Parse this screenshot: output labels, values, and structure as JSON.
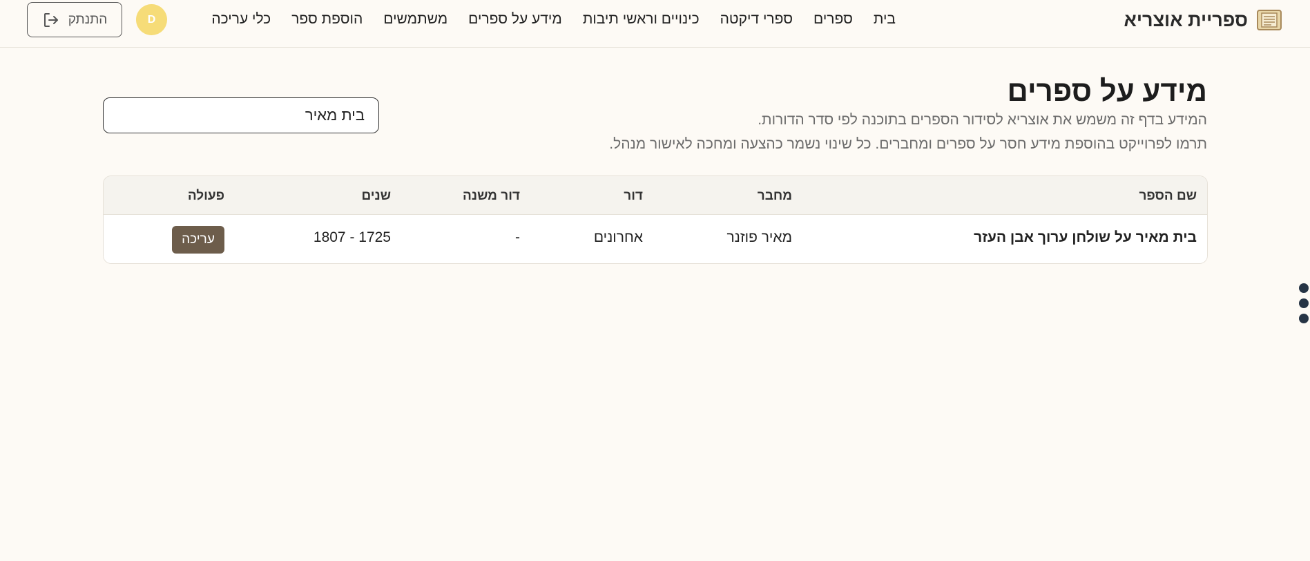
{
  "header": {
    "brand": "ספריית אוצריא",
    "nav": [
      "בית",
      "ספרים",
      "ספרי דיקטה",
      "כינויים וראשי תיבות",
      "מידע על ספרים",
      "משתמשים",
      "הוספת ספר",
      "כלי עריכה"
    ],
    "avatar_initial": "D",
    "logout_label": "התנתק"
  },
  "page": {
    "title": "מידע על ספרים",
    "description_1": "המידע בדף זה משמש את אוצריא לסידור הספרים בתוכנה לפי סדר הדורות.",
    "description_2": "תרמו לפרוייקט בהוספת מידע חסר על ספרים ומחברים. כל שינוי נשמר כהצעה ומחכה לאישור מנהל."
  },
  "search": {
    "value": "בית מאיר"
  },
  "table": {
    "columns": [
      "שם הספר",
      "מחבר",
      "דור",
      "דור משנה",
      "שנים",
      "פעולה"
    ],
    "rows": [
      {
        "name": "בית מאיר על שולחן ערוך אבן העזר",
        "author": "מאיר פוזנר",
        "generation": "אחרונים",
        "sub_generation": "-",
        "years": "1807 - 1725",
        "action": "עריכה"
      }
    ]
  },
  "icons": {
    "brand": "book-icon",
    "logout": "logout-icon",
    "menu": "vertical-dots-icon"
  },
  "colors": {
    "background": "#fdfaf5",
    "avatar": "#f6dc78",
    "edit_button": "#6d5d4b"
  }
}
